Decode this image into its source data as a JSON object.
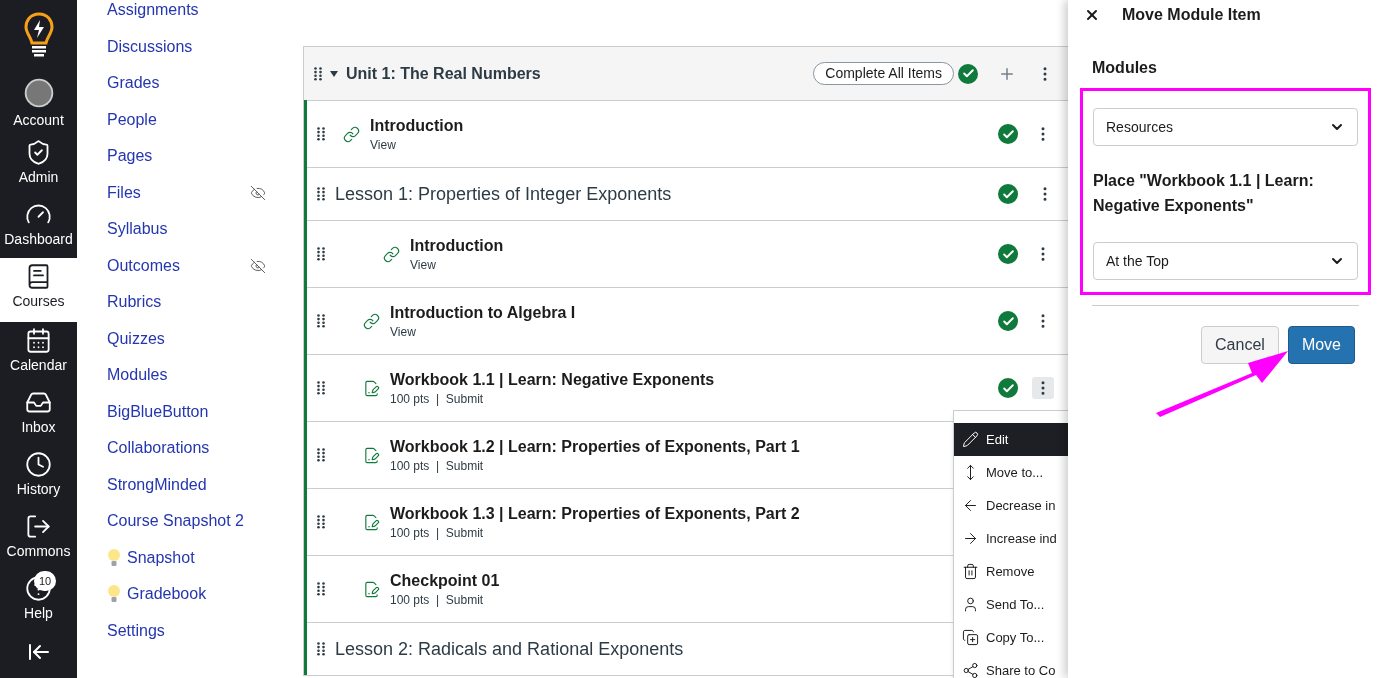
{
  "global_nav": [
    {
      "label": "Account",
      "kind": "account",
      "selected": false
    },
    {
      "label": "Admin",
      "kind": "admin",
      "selected": false
    },
    {
      "label": "Dashboard",
      "kind": "dashboard",
      "selected": false
    },
    {
      "label": "Courses",
      "kind": "courses",
      "selected": true
    },
    {
      "label": "Calendar",
      "kind": "calendar",
      "selected": false
    },
    {
      "label": "Inbox",
      "kind": "inbox",
      "selected": false
    },
    {
      "label": "History",
      "kind": "history",
      "selected": false
    },
    {
      "label": "Commons",
      "kind": "commons",
      "selected": false
    },
    {
      "label": "Help",
      "kind": "help",
      "selected": false,
      "badge": "10"
    }
  ],
  "course_nav": [
    {
      "label": "Assignments",
      "hidden": false,
      "kind": "plain"
    },
    {
      "label": "Discussions",
      "hidden": false,
      "kind": "plain"
    },
    {
      "label": "Grades",
      "hidden": false,
      "kind": "plain"
    },
    {
      "label": "People",
      "hidden": false,
      "kind": "plain"
    },
    {
      "label": "Pages",
      "hidden": false,
      "kind": "plain"
    },
    {
      "label": "Files",
      "hidden": true,
      "kind": "plain"
    },
    {
      "label": "Syllabus",
      "hidden": false,
      "kind": "plain"
    },
    {
      "label": "Outcomes",
      "hidden": true,
      "kind": "plain"
    },
    {
      "label": "Rubrics",
      "hidden": false,
      "kind": "plain"
    },
    {
      "label": "Quizzes",
      "hidden": false,
      "kind": "plain"
    },
    {
      "label": "Modules",
      "hidden": false,
      "kind": "plain"
    },
    {
      "label": "BigBlueButton",
      "hidden": false,
      "kind": "plain"
    },
    {
      "label": "Collaborations",
      "hidden": false,
      "kind": "plain"
    },
    {
      "label": "StrongMinded",
      "hidden": false,
      "kind": "plain"
    },
    {
      "label": "Course Snapshot 2",
      "hidden": false,
      "kind": "plain"
    },
    {
      "label": "Snapshot",
      "hidden": false,
      "kind": "bulb"
    },
    {
      "label": "Gradebook",
      "hidden": false,
      "kind": "bulb"
    },
    {
      "label": "Settings",
      "hidden": false,
      "kind": "plain"
    }
  ],
  "module": {
    "title": "Unit 1: The Real Numbers",
    "expanded": true,
    "complete_button": "Complete All Items",
    "completed": true,
    "items": [
      {
        "kind": "link",
        "title": "Introduction",
        "meta": "View",
        "completed": true
      },
      {
        "kind": "subheader",
        "title": "Lesson 1: Properties of Integer Exponents",
        "completed": true,
        "children": [
          {
            "kind": "indent",
            "children": [
              {
                "kind": "link",
                "title": "Introduction",
                "meta": "View",
                "completed": true
              }
            ]
          },
          {
            "kind": "link",
            "title": "Introduction to Algebra I",
            "meta": "View",
            "completed": true
          },
          {
            "kind": "assignment",
            "title": "Workbook 1.1 | Learn: Negative Exponents",
            "meta": "100 pts  |  Submit",
            "completed": true,
            "menu_open": true
          },
          {
            "kind": "assignment",
            "title": "Workbook 1.2 | Learn: Properties of Exponents, Part 1",
            "meta": "100 pts  |  Submit"
          },
          {
            "kind": "assignment",
            "title": "Workbook 1.3 | Learn: Properties of Exponents, Part 2",
            "meta": "100 pts  |  Submit"
          },
          {
            "kind": "assignment",
            "title": "Checkpoint 01",
            "meta": "100 pts  |  Submit"
          }
        ]
      },
      {
        "kind": "subheader",
        "title": "Lesson 2: Radicals and Rational Exponents"
      }
    ]
  },
  "item_menu": [
    {
      "kind": "edit",
      "label": "Edit",
      "selected": true
    },
    {
      "kind": "move",
      "label": "Move to...",
      "selected": false
    },
    {
      "kind": "decrease",
      "label": "Decrease in",
      "selected": false
    },
    {
      "kind": "increase",
      "label": "Increase ind",
      "selected": false
    },
    {
      "kind": "remove",
      "label": "Remove",
      "selected": false
    },
    {
      "kind": "send",
      "label": "Send To...",
      "selected": false
    },
    {
      "kind": "copy",
      "label": "Copy To...",
      "selected": false
    },
    {
      "kind": "share",
      "label": "Share to Co",
      "selected": false
    }
  ],
  "tray": {
    "title": "Move Module Item",
    "modules_label": "Modules",
    "module_select": "Resources",
    "place_label": "Place \"Workbook 1.1 | Learn: Negative Exponents\"",
    "position_select": "At the Top",
    "buttons": [
      {
        "kind": "secondary",
        "label": "Cancel"
      },
      {
        "kind": "primary",
        "label": "Move"
      }
    ]
  }
}
